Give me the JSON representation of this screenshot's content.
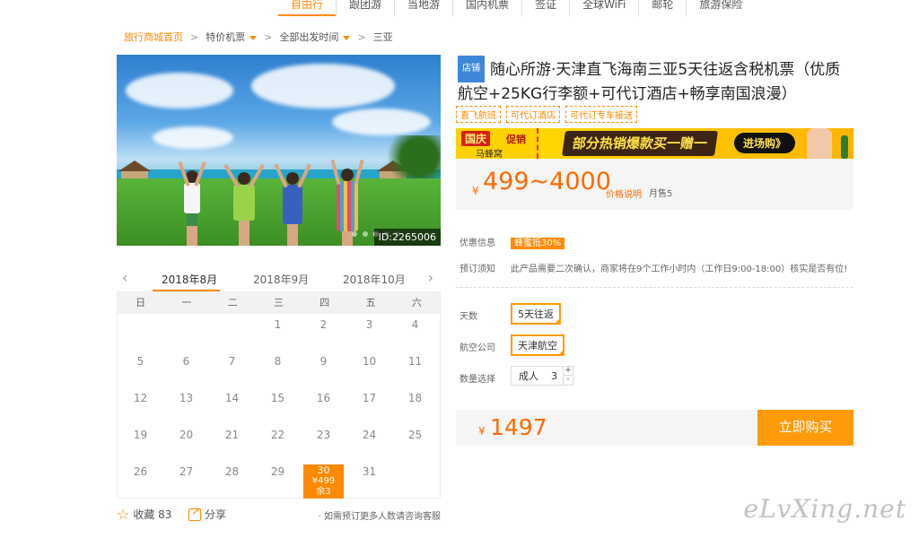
{
  "nav": {
    "items": [
      "自由行",
      "跟团游",
      "当地游",
      "国内机票",
      "签证",
      "全球WiFi",
      "邮轮",
      "旅游保险"
    ],
    "active_index": 0
  },
  "breadcrumb": {
    "home": "旅行商城首页",
    "sep": ">",
    "items": [
      "特价机票",
      "全部出发时间",
      "三亚"
    ]
  },
  "hero": {
    "id_tag": "ID:2265006",
    "slide_count": 5,
    "active_slide": 3
  },
  "calendar": {
    "prev_arrow": "‹",
    "next_arrow": "›",
    "months": [
      "2018年8月",
      "2018年9月",
      "2018年10月"
    ],
    "active_month": 0,
    "weekdays": [
      "日",
      "一",
      "二",
      "三",
      "四",
      "五",
      "六"
    ],
    "days": [
      "",
      "",
      "",
      "1",
      "2",
      "3",
      "4",
      "5",
      "6",
      "7",
      "8",
      "9",
      "10",
      "11",
      "12",
      "13",
      "14",
      "15",
      "16",
      "17",
      "18",
      "19",
      "20",
      "21",
      "22",
      "23",
      "24",
      "25",
      "26",
      "27",
      "28",
      "29",
      "30",
      "31",
      ""
    ],
    "selected_day": "30",
    "selected_price": "¥499",
    "selected_left": "余3"
  },
  "bottom": {
    "fav_label": "收藏 83",
    "share_label": "分享",
    "tip": "· 如需预订更多人数请咨询客服"
  },
  "product": {
    "shop_badge": "店铺",
    "title": "随心所游·天津直飞海南三亚5天往返含税机票（优质航空+25KG行李额+可代订酒店+畅享南国浪漫）",
    "tags": [
      "直飞航班",
      "可代订酒店",
      "可代订专车接送"
    ]
  },
  "banner": {
    "guoqing": "国庆",
    "cuxiao": "促销",
    "brand": "马蜂窝",
    "middle": "部分热销爆款买一赠一",
    "button": "进场购》"
  },
  "price": {
    "currency": "¥",
    "range": "499~4000",
    "explain": "价格说明",
    "sold": "月售5"
  },
  "info": {
    "discount_label": "优惠信息",
    "discount_value": "蜂蜜抵30%",
    "notice_label": "预订须知",
    "notice_value": "此产品需要二次确认，商家将在9个工作小时内（工作日9:00-18:00）核实是否有位!"
  },
  "options": {
    "days_label": "天数",
    "days_value": "5天往返",
    "airline_label": "航空公司",
    "airline_value": "天津航空",
    "qty_label": "数量选择",
    "qty_type": "成人",
    "qty_value": "3",
    "plus": "+",
    "minus": "-"
  },
  "total": {
    "currency": "¥",
    "amount": "1497",
    "buy_label": "立即购买"
  },
  "watermark": "eLvXing.net",
  "colors": {
    "accent": "#ff8a00",
    "price": "#ff6a00",
    "badge_blue": "#3e87d8"
  }
}
